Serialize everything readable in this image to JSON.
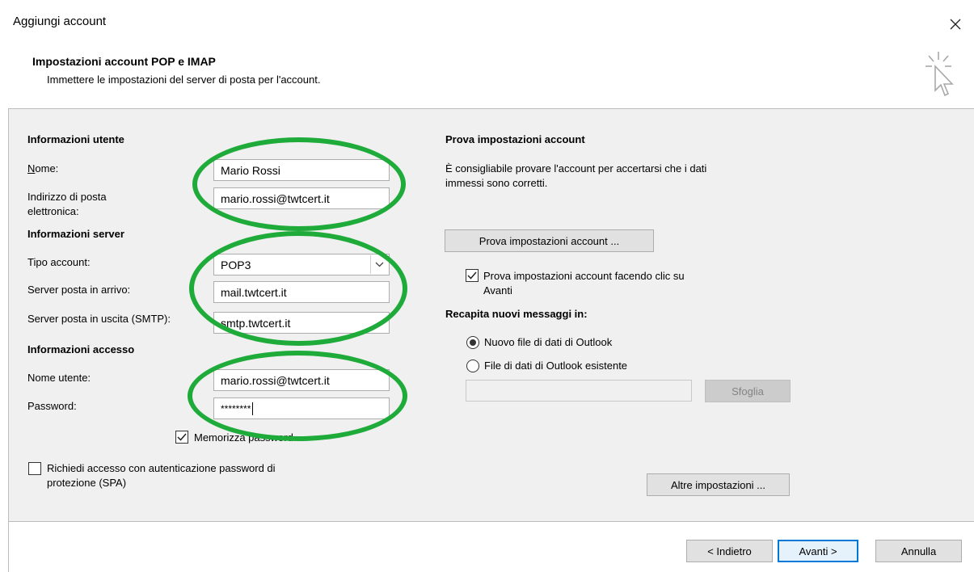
{
  "window": {
    "title": "Aggiungi account"
  },
  "header": {
    "title": "Impostazioni account POP e IMAP",
    "subtitle": "Immettere le impostazioni del server di posta per l'account."
  },
  "user_info": {
    "section_title": "Informazioni utente",
    "name_label": "Nome:",
    "name_value": "Mario Rossi",
    "email_label_line1": "Indirizzo di posta",
    "email_label_line2": "elettronica:",
    "email_value": "mario.rossi@twtcert.it"
  },
  "server_info": {
    "section_title": "Informazioni server",
    "account_type_label": "Tipo account:",
    "account_type_value": "POP3",
    "incoming_label": "Server posta in arrivo:",
    "incoming_value": "mail.twtcert.it",
    "outgoing_label": "Server posta in uscita (SMTP):",
    "outgoing_value": "smtp.twtcert.it"
  },
  "login_info": {
    "section_title": "Informazioni accesso",
    "username_label": "Nome utente:",
    "username_value": "mario.rossi@twtcert.it",
    "password_label": "Password:",
    "password_value": "********",
    "remember_label": "Memorizza password",
    "remember_checked": true,
    "spa_label_line1": "Richiedi accesso con autenticazione password di",
    "spa_label_line2": "protezione (SPA)",
    "spa_checked": false
  },
  "test_settings": {
    "section_title": "Prova impostazioni account",
    "description_line1": "È consigliabile provare l'account per accertarsi che i dati",
    "description_line2": "immessi sono corretti.",
    "test_button": "Prova impostazioni account ...",
    "test_on_next_line1": "Prova impostazioni account facendo clic su",
    "test_on_next_line2": "Avanti",
    "test_on_next_checked": true
  },
  "delivery": {
    "section_title": "Recapita nuovi messaggi in:",
    "option_new": "Nuovo file di dati di Outlook",
    "option_existing": "File di dati di Outlook esistente",
    "selected": "new",
    "path_value": "",
    "browse_button": "Sfoglia"
  },
  "more_settings_button": "Altre impostazioni ...",
  "footer": {
    "back_button": "< Indietro",
    "next_button": "Avanti >",
    "cancel_button": "Annulla"
  },
  "colors": {
    "accent": "#0078d7",
    "highlight_ellipse": "#1eab3a",
    "panel_bg": "#f0f0f0"
  }
}
